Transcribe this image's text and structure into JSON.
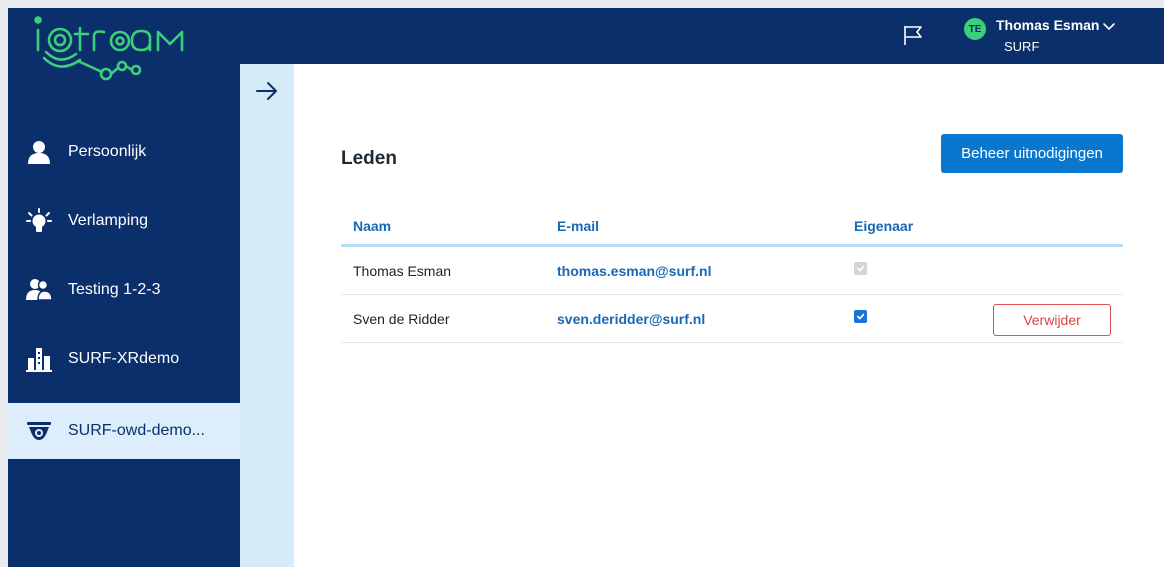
{
  "app": {
    "logo_text": "iotream",
    "brand_color": "#0b2f6a",
    "accent_color": "#3ccf7a"
  },
  "header": {
    "flag_icon": "flag-icon",
    "user": {
      "initials": "TE",
      "name": "Thomas Esman",
      "organization": "SURF",
      "menu_icon": "chevron-down-icon"
    }
  },
  "sidebar": {
    "collapse_icon": "arrow-right-icon",
    "items": [
      {
        "label": "Persoonlijk",
        "icon": "person-icon",
        "active": false
      },
      {
        "label": "Verlamping",
        "icon": "lamp-icon",
        "active": false
      },
      {
        "label": "Testing 1-2-3",
        "icon": "group-icon",
        "active": false
      },
      {
        "label": "SURF-XRdemo",
        "icon": "city-icon",
        "active": false
      },
      {
        "label": "SURF-owd-demo...",
        "icon": "camera-icon",
        "active": true
      }
    ]
  },
  "main": {
    "title": "Leden",
    "manage_invites_label": "Beheer uitnodigingen",
    "table": {
      "headers": {
        "name": "Naam",
        "email": "E-mail",
        "owner": "Eigenaar"
      },
      "rows": [
        {
          "name": "Thomas Esman",
          "email": "thomas.esman@surf.nl",
          "owner": true,
          "owner_editable": false,
          "remove_label": ""
        },
        {
          "name": "Sven de Ridder",
          "email": "sven.deridder@surf.nl",
          "owner": true,
          "owner_editable": true,
          "remove_label": "Verwijder"
        }
      ]
    }
  }
}
